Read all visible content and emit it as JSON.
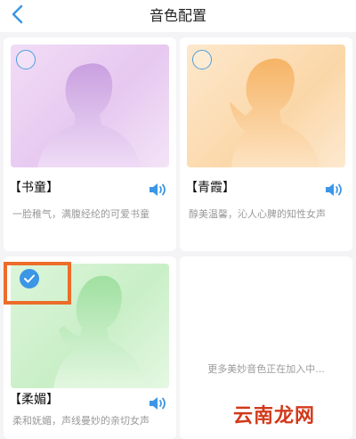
{
  "header": {
    "title": "音色配置"
  },
  "voices": [
    {
      "name": "【书童】",
      "desc": "一脸稚气，满腹经纶的可爱书童",
      "selected": false
    },
    {
      "name": "【青霞】",
      "desc": "醇美温馨，沁人心脾的知性女声",
      "selected": false
    },
    {
      "name": "【柔媚】",
      "desc": "柔和妩媚，声线曼妙的亲切女声",
      "selected": true
    }
  ],
  "more_card": {
    "text": "更多美妙音色正在加入中..."
  },
  "watermark": {
    "text": "云南龙网"
  },
  "colors": {
    "accent": "#3c96e6",
    "highlight": "#ec6d2a"
  }
}
